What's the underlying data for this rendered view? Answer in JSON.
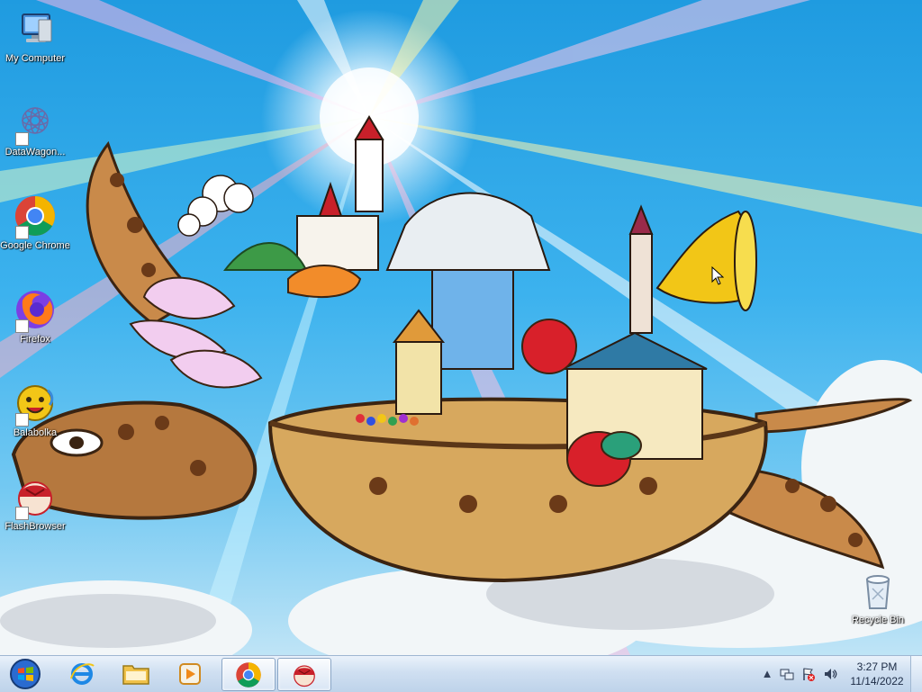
{
  "desktop": {
    "icons": [
      {
        "label": "My Computer",
        "icon": "computer-icon"
      },
      {
        "label": "DataWagon...",
        "icon": "datawagon-icon"
      },
      {
        "label": "Google Chrome",
        "icon": "chrome-icon"
      },
      {
        "label": "Firefox",
        "icon": "firefox-icon"
      },
      {
        "label": "Balabolka",
        "icon": "balabolka-icon"
      },
      {
        "label": "FlashBrowser",
        "icon": "flashbrowser-icon"
      }
    ],
    "recycle_bin": {
      "label": "Recycle Bin",
      "icon": "recycle-bin-icon"
    }
  },
  "taskbar": {
    "start": {
      "icon": "windows-start-icon"
    },
    "pinned": [
      {
        "name": "internet-explorer",
        "icon": "ie-icon"
      },
      {
        "name": "file-explorer",
        "icon": "folder-icon"
      },
      {
        "name": "media-player",
        "icon": "media-player-icon"
      },
      {
        "name": "google-chrome",
        "icon": "chrome-icon",
        "active": true
      },
      {
        "name": "flashbrowser",
        "icon": "flashbrowser-icon",
        "active": true
      }
    ],
    "tray": {
      "show_hidden": "▲",
      "icons": [
        "network-icon",
        "flag-error-icon",
        "volume-icon"
      ]
    },
    "clock": {
      "time": "3:27 PM",
      "date": "11/14/2022"
    }
  },
  "colors": {
    "sky": "#2aa6e6",
    "taskbar": "#cfdff1"
  }
}
